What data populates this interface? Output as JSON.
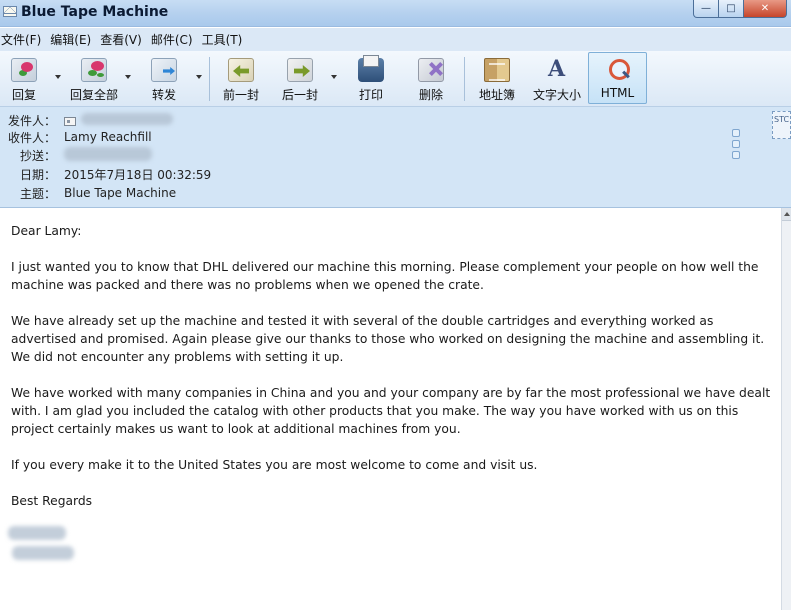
{
  "window": {
    "title": "Blue Tape Machine",
    "controls": {
      "minimize": "—",
      "maximize": "□",
      "close": "✕"
    }
  },
  "menu": {
    "items": [
      "文件(F)",
      "编辑(E)",
      "查看(V)",
      "邮件(C)",
      "工具(T)"
    ]
  },
  "toolbar": {
    "buttons": [
      {
        "label": "回复",
        "icon": "reply-icon"
      },
      {
        "label": "回复全部",
        "icon": "reply-all-icon"
      },
      {
        "label": "转发",
        "icon": "forward-icon"
      },
      {
        "label": "前一封",
        "icon": "previous-icon"
      },
      {
        "label": "后一封",
        "icon": "next-icon"
      },
      {
        "label": "打印",
        "icon": "print-icon"
      },
      {
        "label": "删除",
        "icon": "delete-icon"
      },
      {
        "label": "地址簿",
        "icon": "address-book-icon"
      },
      {
        "label": "文字大小",
        "icon": "font-size-icon"
      },
      {
        "label": "HTML",
        "icon": "html-view-icon",
        "active": true
      }
    ]
  },
  "header": {
    "from_label": "发件人：",
    "to_label": "收件人：",
    "to_value": "Lamy Reachfill",
    "cc_label": "抄送：",
    "date_label": "日期：",
    "date_value": "2015年7月18日 00:32:59",
    "subject_label": "主题：",
    "subject_value": "Blue Tape Machine"
  },
  "message": {
    "greeting": "Dear Lamy:",
    "paragraphs": [
      "I just wanted you to know that DHL delivered our machine this morning.  Please complement your people on how well the machine was packed and there was no problems when we opened the crate.",
      "We have already set up the machine and tested it with several of the double cartridges and everything worked as advertised and promised.  Again please give our thanks to those who worked on designing the machine and assembling it.  We did not encounter any problems with setting it up.",
      "We have worked with many companies in China and you and your company are by far the most professional we have dealt with.  I am glad you included the catalog with other products that you make.  The way you have worked with us on this project certainly makes us want to look at additional machines from you.",
      "If you every make it to the United States you are most welcome to come and visit us."
    ],
    "closing": "Best Regards"
  },
  "colors": {
    "titlebar": "#b4d0ee",
    "menubar": "#dbe8f6",
    "header_bg": "#d3e5f6",
    "active_button": "#c6e2f7",
    "close_button": "#c6452a"
  }
}
